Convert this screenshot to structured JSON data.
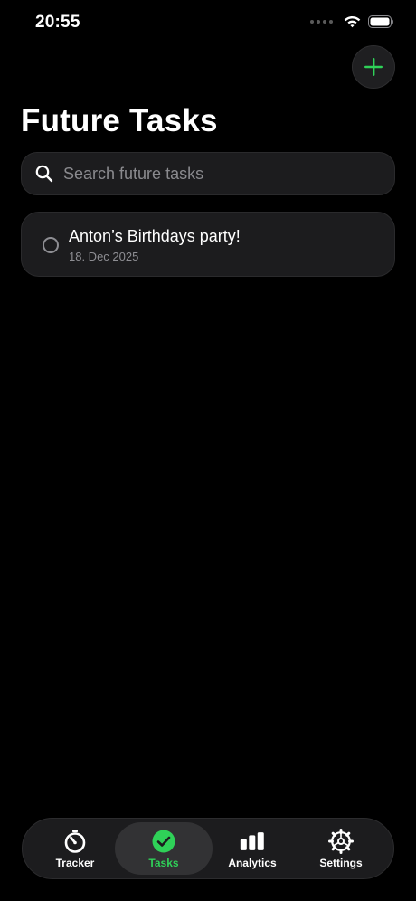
{
  "status_bar": {
    "time": "20:55"
  },
  "header": {
    "title": "Future Tasks",
    "add_icon": "plus-icon"
  },
  "search": {
    "placeholder": "Search future tasks",
    "value": ""
  },
  "tasks": [
    {
      "title": "Anton’s Birthdays party!",
      "date": "18. Dec 2025",
      "completed": false
    }
  ],
  "tab_bar": {
    "selected": "Tasks",
    "tabs": [
      {
        "label": "Tracker",
        "icon": "timer-icon"
      },
      {
        "label": "Tasks",
        "icon": "checkmark-circle-icon"
      },
      {
        "label": "Analytics",
        "icon": "bar-chart-icon"
      },
      {
        "label": "Settings",
        "icon": "gear-icon"
      }
    ]
  },
  "colors": {
    "accent": "#2fd158",
    "background": "#000000",
    "card": "#1c1c1e",
    "secondary_text": "#8e8e93"
  }
}
